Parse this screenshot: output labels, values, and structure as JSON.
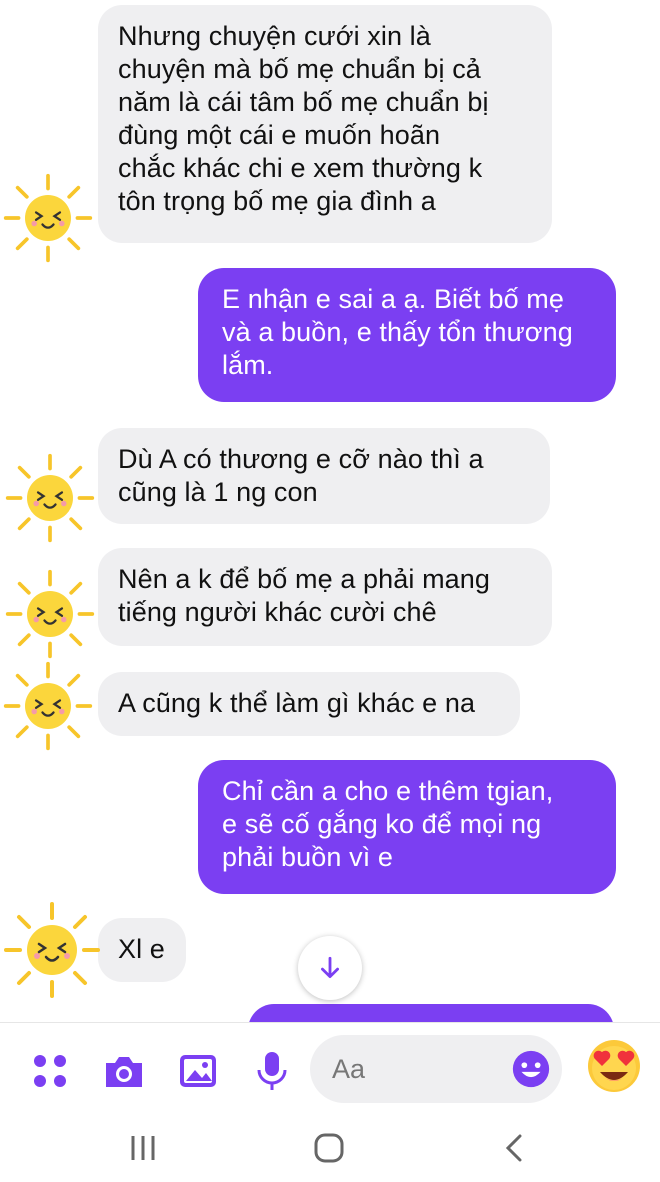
{
  "messages": [
    {
      "side": "in",
      "lines": [
        "Nhưng chuyện cưới xin là",
        "chuyện mà bố mẹ chuẩn bị cả",
        "năm là cái tâm bố mẹ chuẩn bị",
        "đùng một cái e muốn hoãn",
        "chắc khác chi e xem thường k",
        "tôn trọng bố mẹ gia đình a"
      ]
    },
    {
      "side": "out",
      "lines": [
        "E nhận e sai a ạ. Biết bố mẹ",
        "và a buồn, e thấy tổn thương",
        "lắm."
      ]
    },
    {
      "side": "in",
      "lines": [
        "Dù A có thương e cỡ nào thì a",
        "cũng là 1 ng con"
      ]
    },
    {
      "side": "in",
      "lines": [
        "Nên a k để bố mẹ a phải mang",
        "tiếng người khác cười chê"
      ]
    },
    {
      "side": "in",
      "lines": [
        "A cũng k thể làm gì khác e na"
      ]
    },
    {
      "side": "out",
      "lines": [
        "Chỉ cần a cho e thêm tgian,",
        "e sẽ cố gắng ko để mọi ng",
        "phải buồn vì e"
      ]
    },
    {
      "side": "in",
      "lines": [
        "Xl e"
      ]
    }
  ],
  "composer": {
    "placeholder": "Aa",
    "icons": [
      "apps-icon",
      "camera-icon",
      "gallery-icon",
      "microphone-icon",
      "emoji-icon",
      "heart-eyes-emoji"
    ]
  },
  "navbar": {
    "icons": [
      "recent-apps-icon",
      "home-icon",
      "back-icon"
    ]
  },
  "colors": {
    "accent": "#7b3ff2",
    "incoming_bubble": "#efeff1",
    "sun": "#f7c52a"
  }
}
